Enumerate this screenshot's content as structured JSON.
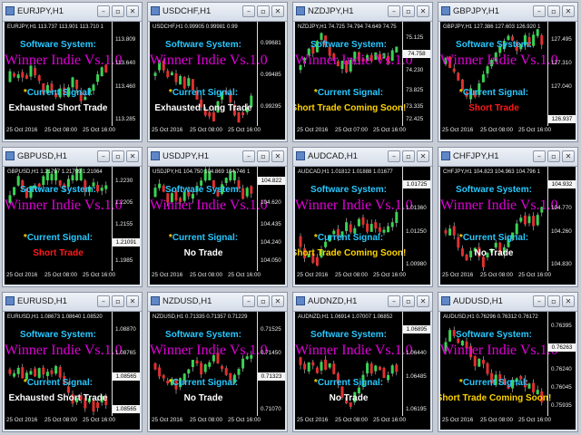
{
  "colors": {
    "white": "#ffffff",
    "red": "#ff1a1a",
    "yellow": "#ffd400",
    "cyan": "#28c8ff",
    "magenta": "#e000d8"
  },
  "buttons": {
    "minimize": "–",
    "restore": "▫",
    "close": "✕"
  },
  "labels": {
    "software_system": "Software System:",
    "product": "GWinner Indie Vs.1.0",
    "current_signal": "Current Signal:",
    "signal_star": "*"
  },
  "windows": [
    {
      "title": "EURJPY,H1",
      "info": "EURJPY,H1 113.737 113.901 113.710 1",
      "ticks": [
        "113.809",
        "113.640",
        "113.460",
        "113.285"
      ],
      "price_tag": "",
      "dates": [
        "25 Oct 2016",
        "25 Oct 08:00",
        "25 Oct 16:00"
      ],
      "signal": "Exhausted Short Trade",
      "signal_color": "#ffffff"
    },
    {
      "title": "USDCHF,H1",
      "info": "USDCHF,H1 0.99905 0.99981 0.99",
      "ticks": [
        "0.99681",
        "0.99485",
        "0.99295"
      ],
      "price_tag": "",
      "dates": [
        "25 Oct 2016",
        "25 Oct 08:00",
        "25 Oct 16:00"
      ],
      "signal": "Exhausted Long Trade",
      "signal_color": "#ffffff"
    },
    {
      "title": "NZDJPY,H1",
      "info": "NZDJPY,H1 74.725 74.794 74.649 74.75",
      "ticks": [
        "75.125",
        "74.758",
        "74.230",
        "73.825",
        "73.335",
        "72.425"
      ],
      "price_tag": "74.758",
      "dates": [
        "25 Oct 2016",
        "25 Oct 07:00",
        "25 Oct 16:00"
      ],
      "signal": "Short Trade Coming Soon!",
      "signal_color": "#ffd400"
    },
    {
      "title": "GBPJPY,H1",
      "info": "GBPJPY,H1 127.386 127.603 126.920 1",
      "ticks": [
        "127.495",
        "127.310",
        "127.040",
        "126.937"
      ],
      "price_tag": "126.937",
      "dates": [
        "25 Oct 2016",
        "25 Oct 08:00",
        "25 Oct 16:00"
      ],
      "signal": "Short Trade",
      "signal_color": "#ff1a1a"
    },
    {
      "title": "GBPUSD,H1",
      "info": "GBPUSD,H1 1.21797 1.21799 1.21064",
      "ticks": [
        "1.2230",
        "1.2205",
        "1.2155",
        "1.21091",
        "1.1985"
      ],
      "price_tag": "1.21091",
      "dates": [
        "25 Oct 2016",
        "25 Oct 08:00",
        "25 Oct 16:00"
      ],
      "signal": "Short Trade",
      "signal_color": "#ff1a1a"
    },
    {
      "title": "USDJPY,H1",
      "info": "USDJPY,H1 104.750 104.869 104.746 1",
      "ticks": [
        "104.822",
        "104.620",
        "104.435",
        "104.240",
        "104.050"
      ],
      "price_tag": "104.822",
      "dates": [
        "25 Oct 2016",
        "25 Oct 08:00",
        "25 Oct 16:00"
      ],
      "signal": "No Trade",
      "signal_color": "#ffffff"
    },
    {
      "title": "AUDCAD,H1",
      "info": "AUDCAD,H1 1.01812 1.01888 1.01677",
      "ticks": [
        "1.01725",
        "1.01360",
        "1.01250",
        "1.00980"
      ],
      "price_tag": "1.01725",
      "dates": [
        "25 Oct 2016",
        "25 Oct 08:00",
        "25 Oct 16:00"
      ],
      "signal": "Short Trade Coming Soon!",
      "signal_color": "#ffd400"
    },
    {
      "title": "CHFJPY,H1",
      "info": "CHFJPY,H1 104.823 104.963 104.796 1",
      "ticks": [
        "104.932",
        "104.770",
        "104.260",
        "104.830"
      ],
      "price_tag": "104.932",
      "dates": [
        "25 Oct 2016",
        "25 Oct 08:00",
        "25 Oct 16:00"
      ],
      "signal": "No Trade",
      "signal_color": "#ffffff"
    },
    {
      "title": "EURUSD,H1",
      "info": "EURUSD,H1 1.08673 1.08640 1.08520",
      "ticks": [
        "1.08870",
        "1.08765",
        "1.08565",
        "1.08565"
      ],
      "price_tag": "1.08565",
      "dates": [
        "25 Oct 2016",
        "25 Oct 08:00",
        "25 Oct 16:00"
      ],
      "signal": "Exhausted Short Trade",
      "signal_color": "#ffffff"
    },
    {
      "title": "NZDUSD,H1",
      "info": "NZDUSD,H1 0.71335 0.71357 0.71229",
      "ticks": [
        "0.71525",
        "0.71450",
        "0.71323",
        "0.71070"
      ],
      "price_tag": "0.71323",
      "dates": [
        "25 Oct 2016",
        "25 Oct 08:00",
        "25 Oct 16:00"
      ],
      "signal": "No Trade",
      "signal_color": "#ffffff"
    },
    {
      "title": "AUDNZD,H1",
      "info": "AUDNZD,H1 1.06914 1.07007 1.06852",
      "ticks": [
        "1.06895",
        "1.06440",
        "1.06485",
        "1.06195"
      ],
      "price_tag": "1.06895",
      "dates": [
        "25 Oct 2016",
        "25 Oct 08:00",
        "25 Oct 16:00"
      ],
      "signal": "No Trade",
      "signal_color": "#ffffff"
    },
    {
      "title": "AUDUSD,H1",
      "info": "AUDUSD,H1 0.76296 0.76312 0.76172",
      "ticks": [
        "0.76395",
        "0.76263",
        "0.76240",
        "0.76045",
        "0.75935"
      ],
      "price_tag": "0.76263",
      "dates": [
        "25 Oct 2016",
        "25 Oct 08:00",
        "25 Oct 16:00"
      ],
      "signal": "Short Trade Coming Soon!",
      "signal_color": "#ffd400"
    }
  ]
}
